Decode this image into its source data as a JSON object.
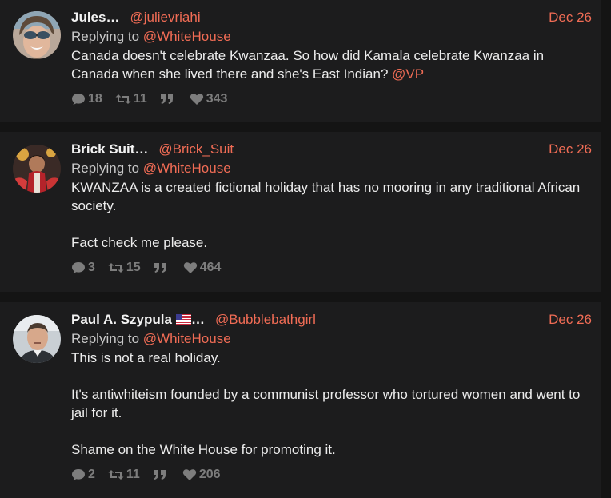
{
  "colors": {
    "accent": "#f06c55",
    "background": "#141414",
    "card": "#1c1c1d",
    "muted": "#7d7d7d"
  },
  "tweets": [
    {
      "name": "Jules…",
      "handle": "@julievriahi",
      "date": "Dec 26",
      "replying_prefix": "Replying to",
      "replying_to": "@WhiteHouse",
      "body_text": "Canada doesn't celebrate Kwanzaa. So how did Kamala celebrate Kwanzaa in Canada when she lived there and she's East Indian?",
      "body_mention": "@VP",
      "replies": "18",
      "retweets": "11",
      "likes": "343"
    },
    {
      "name": "Brick Suit…",
      "handle": "@Brick_Suit",
      "date": "Dec 26",
      "replying_prefix": "Replying to",
      "replying_to": "@WhiteHouse",
      "paragraphs": [
        "KWANZAA is a created fictional holiday that has no mooring in any traditional African society.",
        "Fact check me please."
      ],
      "replies": "3",
      "retweets": "15",
      "likes": "464"
    },
    {
      "name": "Paul A. Szypula",
      "name_suffix": "…",
      "flag_icon": "us-flag-icon",
      "handle": "@Bubblebathgirl",
      "date": "Dec 26",
      "replying_prefix": "Replying to",
      "replying_to": "@WhiteHouse",
      "paragraphs": [
        "This is not a real holiday.",
        "It's antiwhiteism founded by a communist professor who tortured women and went to jail for it.",
        "Shame on the White House for promoting it."
      ],
      "replies": "2",
      "retweets": "11",
      "likes": "206"
    }
  ]
}
